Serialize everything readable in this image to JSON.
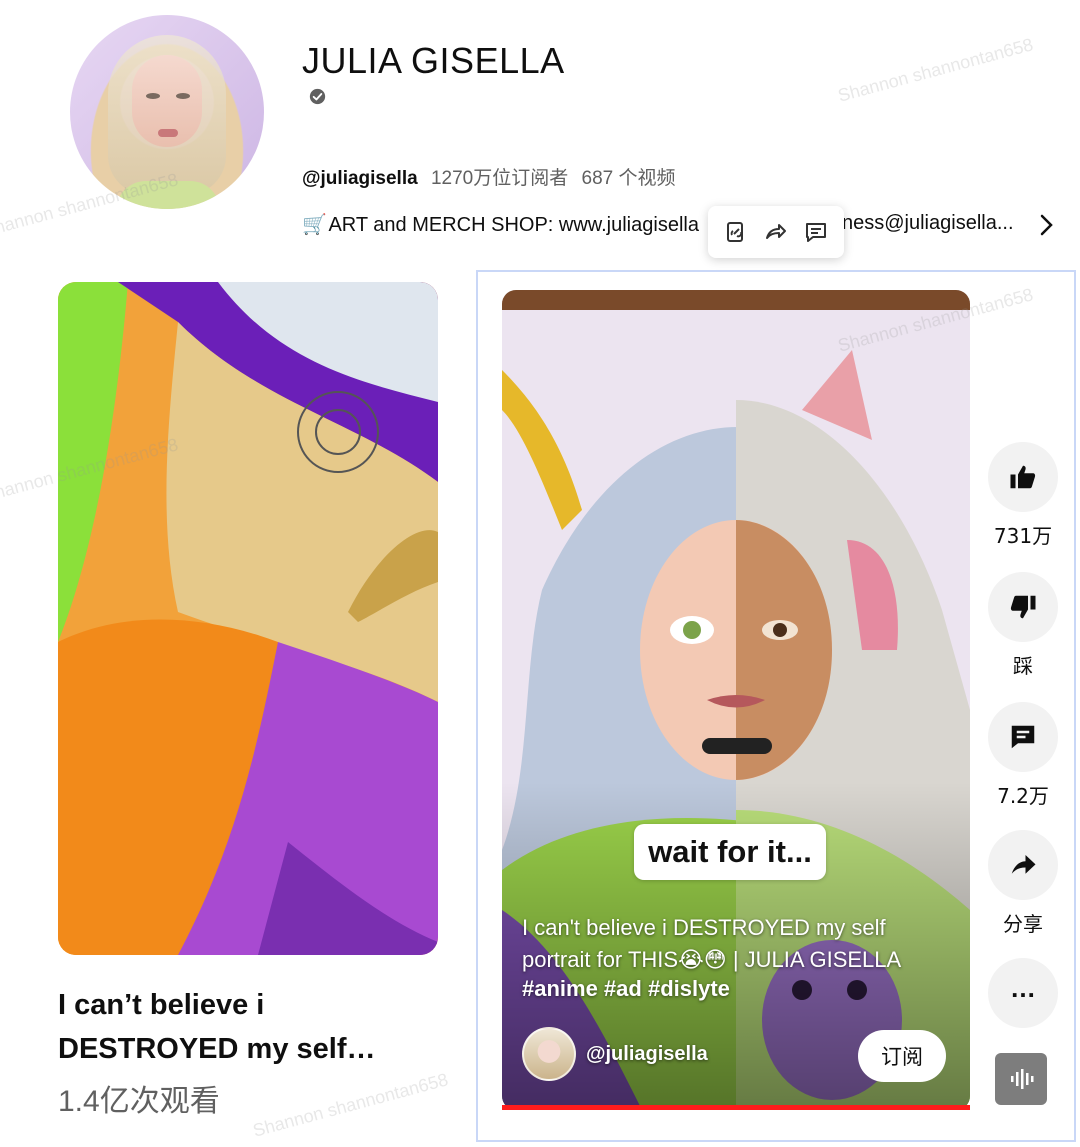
{
  "channel": {
    "name": "JULIA GISELLA",
    "handle": "@juliagisella",
    "subscribers": "1270万位订阅者",
    "video_count": "687 个视频",
    "description_start": "ART and MERCH SHOP: www.juliagisella",
    "description_end": "ness@juliagisella...",
    "cart_icon": "🛒"
  },
  "shorts": [
    {
      "title": "I can’t believe i DESTROYED my self…",
      "views": "1.4亿次观看"
    }
  ],
  "player": {
    "overlay_caption": "wait for it...",
    "title": "I can't believe i DESTROYED my self portrait for THIS😭😳 | JULIA GISELLA",
    "hashtags": "#anime #ad #dislyte",
    "channel_handle": "@juliagisella",
    "subscribe_label": "订阅",
    "progress_percent": 100
  },
  "actions": {
    "like_count": "731万",
    "dislike_label": "踩",
    "comment_count": "7.2万",
    "share_label": "分享",
    "more_label": "…"
  },
  "watermark": {
    "text": "Shannon shannontan658"
  },
  "colors": {
    "progress": "#ff1c1c",
    "action_bg": "#f2f2f2",
    "selection": "#c9d7f7"
  }
}
